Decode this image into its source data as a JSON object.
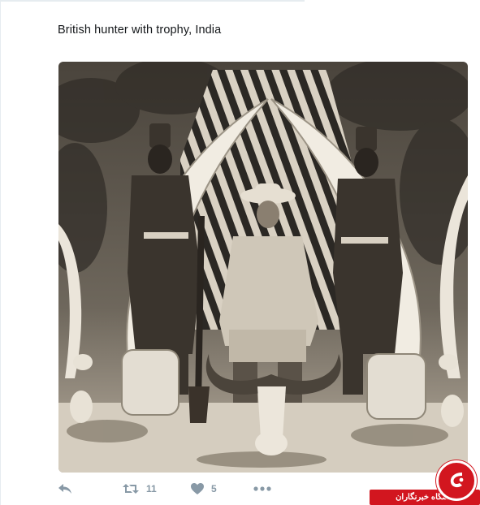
{
  "tweet": {
    "text": "British hunter with trophy, India"
  },
  "actions": {
    "retweet_count": "11",
    "like_count": "5"
  },
  "watermark": {
    "label": "باشگاه خبرنگاران"
  },
  "colors": {
    "action_gray": "#8899a6",
    "watermark_red": "#d2161f",
    "divider": "#e6ecf0"
  },
  "icons": [
    "reply-icon",
    "retweet-icon",
    "heart-icon",
    "more-dots-icon",
    "watermark-logo-icon"
  ]
}
